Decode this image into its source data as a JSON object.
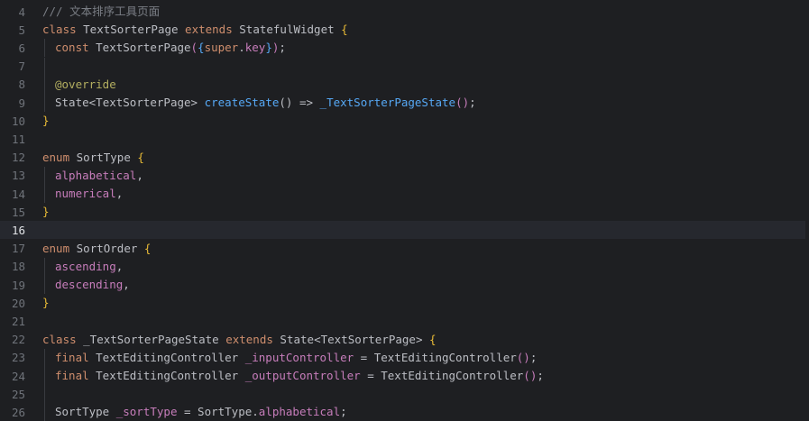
{
  "editor": {
    "current_line": 16,
    "lines": [
      {
        "n": "4",
        "indent": 0,
        "tokens": [
          {
            "t": "/// 文本排序工具页面",
            "c": "cmt"
          }
        ]
      },
      {
        "n": "5",
        "indent": 0,
        "tokens": [
          {
            "t": "class ",
            "c": "kw"
          },
          {
            "t": "TextSorterPage ",
            "c": "cls"
          },
          {
            "t": "extends ",
            "c": "kw"
          },
          {
            "t": "StatefulWidget ",
            "c": "type"
          },
          {
            "t": "{",
            "c": "br1"
          }
        ]
      },
      {
        "n": "6",
        "indent": 1,
        "tokens": [
          {
            "t": "const ",
            "c": "kw"
          },
          {
            "t": "TextSorterPage",
            "c": "cls"
          },
          {
            "t": "(",
            "c": "br2"
          },
          {
            "t": "{",
            "c": "br3"
          },
          {
            "t": "super",
            "c": "kw"
          },
          {
            "t": ".",
            "c": "pun"
          },
          {
            "t": "key",
            "c": "fld"
          },
          {
            "t": "}",
            "c": "br3"
          },
          {
            "t": ")",
            "c": "br2"
          },
          {
            "t": ";",
            "c": "pun"
          }
        ]
      },
      {
        "n": "7",
        "indent": 1,
        "tokens": []
      },
      {
        "n": "8",
        "indent": 1,
        "tokens": [
          {
            "t": "@override",
            "c": "ann"
          }
        ]
      },
      {
        "n": "9",
        "indent": 1,
        "tokens": [
          {
            "t": "State",
            "c": "type"
          },
          {
            "t": "<",
            "c": "pun"
          },
          {
            "t": "TextSorterPage",
            "c": "type"
          },
          {
            "t": "> ",
            "c": "pun"
          },
          {
            "t": "createState",
            "c": "fn"
          },
          {
            "t": "() ",
            "c": "pun"
          },
          {
            "t": "=> ",
            "c": "pun"
          },
          {
            "t": "_TextSorterPageState",
            "c": "fn"
          },
          {
            "t": "()",
            "c": "br2"
          },
          {
            "t": ";",
            "c": "pun"
          }
        ]
      },
      {
        "n": "10",
        "indent": 0,
        "tokens": [
          {
            "t": "}",
            "c": "br1"
          }
        ]
      },
      {
        "n": "11",
        "indent": 0,
        "tokens": []
      },
      {
        "n": "12",
        "indent": 0,
        "tokens": [
          {
            "t": "enum ",
            "c": "kw"
          },
          {
            "t": "SortType ",
            "c": "cls"
          },
          {
            "t": "{",
            "c": "br1"
          }
        ]
      },
      {
        "n": "13",
        "indent": 1,
        "tokens": [
          {
            "t": "alphabetical",
            "c": "fld"
          },
          {
            "t": ",",
            "c": "pun"
          }
        ]
      },
      {
        "n": "14",
        "indent": 1,
        "tokens": [
          {
            "t": "numerical",
            "c": "fld"
          },
          {
            "t": ",",
            "c": "pun"
          }
        ]
      },
      {
        "n": "15",
        "indent": 0,
        "tokens": [
          {
            "t": "}",
            "c": "br1"
          }
        ]
      },
      {
        "n": "16",
        "indent": 0,
        "tokens": []
      },
      {
        "n": "17",
        "indent": 0,
        "tokens": [
          {
            "t": "enum ",
            "c": "kw"
          },
          {
            "t": "SortOrder ",
            "c": "cls"
          },
          {
            "t": "{",
            "c": "br1"
          }
        ]
      },
      {
        "n": "18",
        "indent": 1,
        "tokens": [
          {
            "t": "ascending",
            "c": "fld"
          },
          {
            "t": ",",
            "c": "pun"
          }
        ]
      },
      {
        "n": "19",
        "indent": 1,
        "tokens": [
          {
            "t": "descending",
            "c": "fld"
          },
          {
            "t": ",",
            "c": "pun"
          }
        ]
      },
      {
        "n": "20",
        "indent": 0,
        "tokens": [
          {
            "t": "}",
            "c": "br1"
          }
        ]
      },
      {
        "n": "21",
        "indent": 0,
        "tokens": []
      },
      {
        "n": "22",
        "indent": 0,
        "tokens": [
          {
            "t": "class ",
            "c": "kw"
          },
          {
            "t": "_TextSorterPageState ",
            "c": "cls"
          },
          {
            "t": "extends ",
            "c": "kw"
          },
          {
            "t": "State",
            "c": "type"
          },
          {
            "t": "<",
            "c": "pun"
          },
          {
            "t": "TextSorterPage",
            "c": "type"
          },
          {
            "t": "> ",
            "c": "pun"
          },
          {
            "t": "{",
            "c": "br1"
          }
        ]
      },
      {
        "n": "23",
        "indent": 1,
        "tokens": [
          {
            "t": "final ",
            "c": "kw"
          },
          {
            "t": "TextEditingController ",
            "c": "type"
          },
          {
            "t": "_inputController",
            "c": "fld"
          },
          {
            "t": " = ",
            "c": "pun"
          },
          {
            "t": "TextEditingController",
            "c": "type"
          },
          {
            "t": "()",
            "c": "br2"
          },
          {
            "t": ";",
            "c": "pun"
          }
        ]
      },
      {
        "n": "24",
        "indent": 1,
        "tokens": [
          {
            "t": "final ",
            "c": "kw"
          },
          {
            "t": "TextEditingController ",
            "c": "type"
          },
          {
            "t": "_outputController",
            "c": "fld"
          },
          {
            "t": " = ",
            "c": "pun"
          },
          {
            "t": "TextEditingController",
            "c": "type"
          },
          {
            "t": "()",
            "c": "br2"
          },
          {
            "t": ";",
            "c": "pun"
          }
        ]
      },
      {
        "n": "25",
        "indent": 1,
        "tokens": []
      },
      {
        "n": "26",
        "indent": 1,
        "tokens": [
          {
            "t": "SortType ",
            "c": "type"
          },
          {
            "t": "_sortType",
            "c": "fld"
          },
          {
            "t": " = ",
            "c": "pun"
          },
          {
            "t": "SortType",
            "c": "type"
          },
          {
            "t": ".",
            "c": "pun"
          },
          {
            "t": "alphabetical",
            "c": "fld"
          },
          {
            "t": ";",
            "c": "pun"
          }
        ]
      }
    ]
  }
}
